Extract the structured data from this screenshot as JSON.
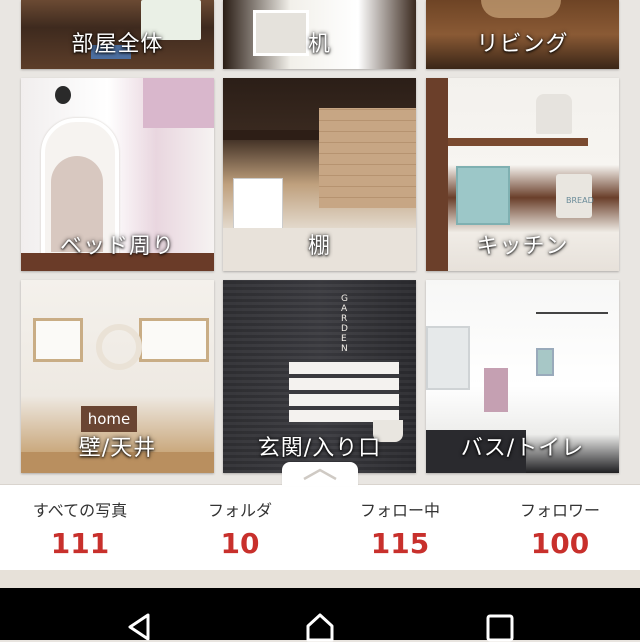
{
  "categories": [
    {
      "label": "部屋全体",
      "icon": "room-photo"
    },
    {
      "label": "机",
      "icon": "desk-photo"
    },
    {
      "label": "リビング",
      "icon": "living-photo"
    },
    {
      "label": "ベッド周り",
      "icon": "bedroom-photo"
    },
    {
      "label": "棚",
      "icon": "shelf-photo"
    },
    {
      "label": "キッチン",
      "icon": "kitchen-photo"
    },
    {
      "label": "壁/天井",
      "icon": "wall-photo"
    },
    {
      "label": "玄関/入り口",
      "icon": "entrance-photo"
    },
    {
      "label": "バス/トイレ",
      "icon": "bathroom-photo"
    }
  ],
  "photo_text": {
    "home_sign": "home",
    "bread_box": "BREAD",
    "garland": "GARDEN"
  },
  "stats": [
    {
      "label": "すべての写真",
      "value": "111"
    },
    {
      "label": "フォルダ",
      "value": "10"
    },
    {
      "label": "フォロー中",
      "value": "115"
    },
    {
      "label": "フォロワー",
      "value": "100"
    }
  ],
  "colors": {
    "stat_value": "#c8302c",
    "accent_text": "#ffffff",
    "nav_bar": "#000000"
  },
  "icons": {
    "collapse": "chevron-up-icon",
    "back": "back-triangle-icon",
    "home": "home-icon",
    "recent": "recent-apps-icon"
  }
}
